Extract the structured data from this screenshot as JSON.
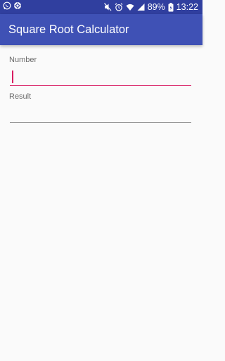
{
  "status_bar": {
    "battery_percent": "89%",
    "time": "13:22",
    "icons_left": [
      "whatsapp-icon",
      "sync-icon"
    ],
    "icons_right": [
      "mute-icon",
      "alarm-icon",
      "wifi-icon",
      "signal-icon",
      "battery-icon"
    ]
  },
  "app_bar": {
    "title": "Square Root Calculator"
  },
  "form": {
    "number_label": "Number",
    "number_value": "",
    "result_label": "Result",
    "result_value": ""
  },
  "colors": {
    "status_bar": "#303f9f",
    "app_bar": "#3f51b5",
    "accent": "#d81b60",
    "background": "#fafafa"
  }
}
